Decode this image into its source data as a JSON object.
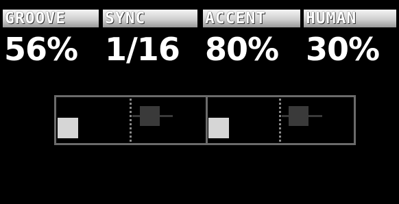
{
  "params": [
    {
      "label": "GROOVE",
      "value": "56%"
    },
    {
      "label": "SYNC",
      "value": "1/16"
    },
    {
      "label": "ACCENT",
      "value": "80%"
    },
    {
      "label": "HUMAN",
      "value": "30%"
    }
  ],
  "colors": {
    "background": "#000000",
    "tab_highlight": "#f4f4f4",
    "value_text": "#ffffff",
    "frame": "#6b6b6b",
    "step_block": "#d6d6d6",
    "swing_handle": "#3a3a3a",
    "beat_marker": "#8a8a8a"
  }
}
